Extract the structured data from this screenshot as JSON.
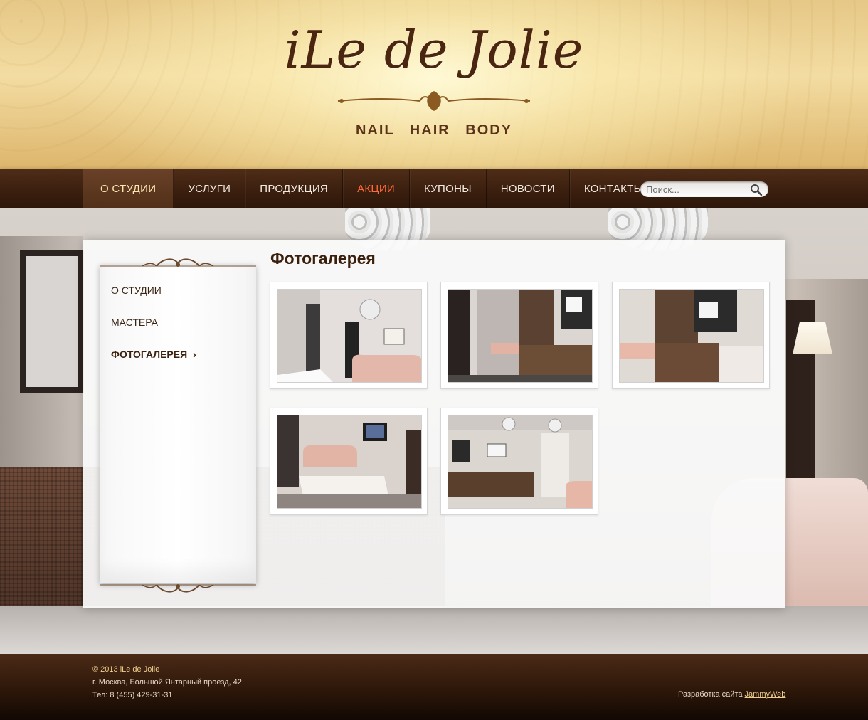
{
  "header": {
    "logo": "iLe de Jolie",
    "tagline": "NAIL  HAIR  BODY"
  },
  "nav": {
    "items": [
      {
        "label": "О СТУДИИ",
        "state": "active"
      },
      {
        "label": "УСЛУГИ"
      },
      {
        "label": "ПРОДУКЦИЯ"
      },
      {
        "label": "АКЦИИ",
        "state": "highlight"
      },
      {
        "label": "КУПОНЫ"
      },
      {
        "label": "НОВОСТИ"
      },
      {
        "label": "КОНТАКТЫ"
      }
    ],
    "search": {
      "placeholder": "Поиск..."
    }
  },
  "sidebar": {
    "items": [
      {
        "label": "О СТУДИИ"
      },
      {
        "label": "МАСТЕРА"
      },
      {
        "label": "ФОТОГАЛЕРЕЯ",
        "state": "active"
      }
    ]
  },
  "main": {
    "title": "Фотогалерея",
    "photos": [
      {
        "name": "lounge-sofa"
      },
      {
        "name": "corridor-reception"
      },
      {
        "name": "reception-desk"
      },
      {
        "name": "waiting-area-tv"
      },
      {
        "name": "reception-hall"
      }
    ]
  },
  "footer": {
    "copyright": "© 2013 iLe de Jolie",
    "address": "г. Москва, Большой Янтарный проезд, 42",
    "phone": "Тел: 8 (455) 429-31-31",
    "dev_prefix": "Разработка сайта",
    "dev_link": "JammyWeb"
  },
  "colors": {
    "brand_brown": "#3a1f0c",
    "promo_orange": "#ff6a3a",
    "gold": "#f0cf8e"
  }
}
